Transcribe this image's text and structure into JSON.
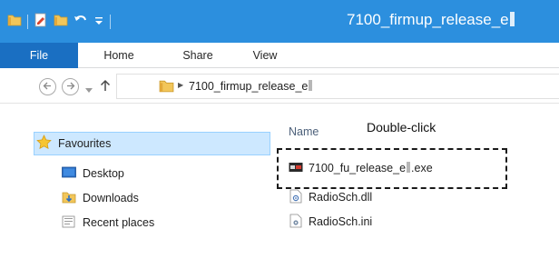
{
  "window": {
    "title": "7100_firmup_release_e",
    "icons": [
      "folder-icon",
      "properties-icon",
      "new-folder-icon",
      "undo-icon",
      "customize-dropdown-icon"
    ]
  },
  "ribbon": {
    "tabs": [
      {
        "label": "File",
        "active": true
      },
      {
        "label": "Home"
      },
      {
        "label": "Share"
      },
      {
        "label": "View"
      }
    ],
    "accent": "#2c8fde",
    "file_tab_color": "#1a6fc2"
  },
  "address": {
    "icons": [
      "back-icon",
      "forward-icon",
      "recent-locations-icon",
      "up-icon",
      "folder-icon",
      "chevron-right-icon"
    ],
    "path": "7100_firmup_release_e"
  },
  "nav_pane": {
    "items": [
      {
        "label": "Favourites",
        "icon": "star-icon",
        "selected": true
      },
      {
        "label": "Desktop",
        "icon": "desktop-icon"
      },
      {
        "label": "Downloads",
        "icon": "downloads-icon"
      },
      {
        "label": "Recent places",
        "icon": "recent-places-icon"
      }
    ]
  },
  "file_list": {
    "column_header": "Name",
    "annotation": "Double-click",
    "files": [
      {
        "prefix": "7100_fu_release_e",
        "suffix": ".exe",
        "icon": "exe-icon",
        "highlighted": true
      },
      {
        "name": "RadioSch.dll",
        "icon": "dll-icon"
      },
      {
        "name": "RadioSch.ini",
        "icon": "ini-icon"
      }
    ]
  }
}
